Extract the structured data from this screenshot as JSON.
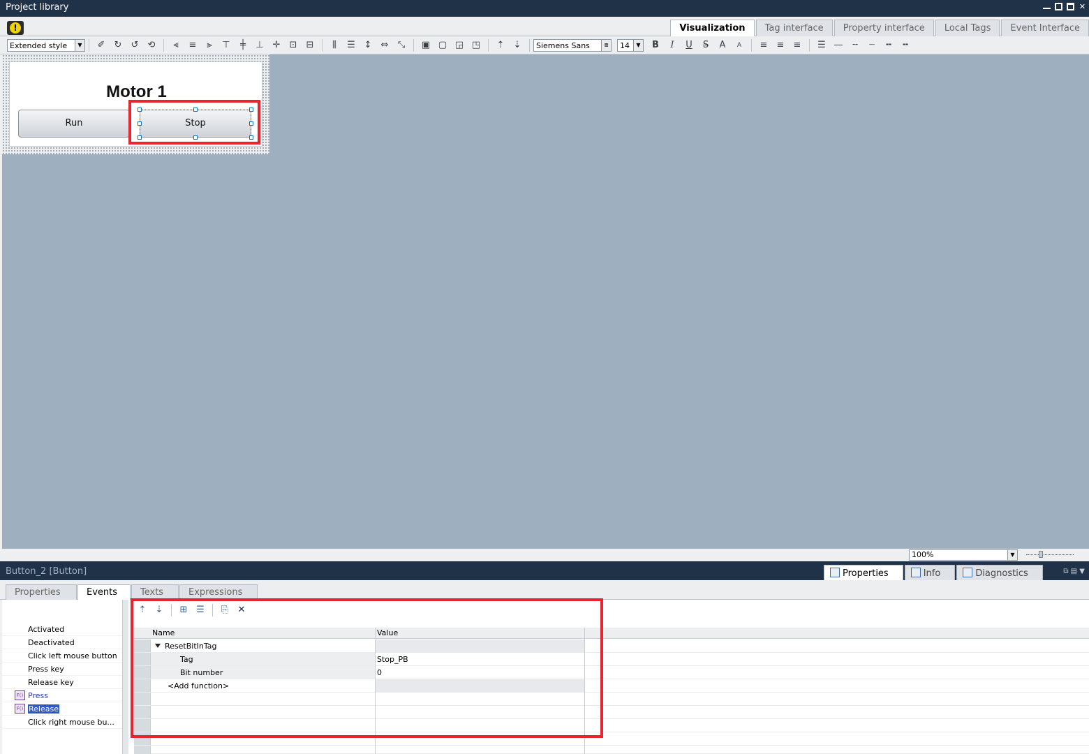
{
  "window": {
    "title": "Project library"
  },
  "top_tabs": [
    {
      "label": "Visualization",
      "active": true
    },
    {
      "label": "Tag interface",
      "active": false
    },
    {
      "label": "Property interface",
      "active": false
    },
    {
      "label": "Local Tags",
      "active": false
    },
    {
      "label": "Event Interface",
      "active": false
    }
  ],
  "toolbar": {
    "style_select": "Extended style",
    "font_select": "Siemens Sans",
    "size_select": "14",
    "bold": "B",
    "italic": "I",
    "underline": "U",
    "strike": "S",
    "grow": "A",
    "shrink": "A"
  },
  "canvas": {
    "screen_title": "Motor 1",
    "run_label": "Run",
    "stop_label": "Stop",
    "zoom": "100%"
  },
  "inspector": {
    "object": "Button_2 [Button]",
    "tabs": [
      {
        "label": "Properties",
        "active": true,
        "icon": "properties-icon"
      },
      {
        "label": "Info",
        "active": false,
        "icon": "info-icon"
      },
      {
        "label": "Diagnostics",
        "active": false,
        "icon": "diagnostics-icon"
      }
    ],
    "subtabs": [
      {
        "label": "Properties",
        "active": false
      },
      {
        "label": "Events",
        "active": true
      },
      {
        "label": "Texts",
        "active": false
      },
      {
        "label": "Expressions",
        "active": false
      }
    ],
    "events": [
      {
        "label": "Activated",
        "has_fn": false
      },
      {
        "label": "Deactivated",
        "has_fn": false
      },
      {
        "label": "Click left mouse button",
        "has_fn": false
      },
      {
        "label": "Press key",
        "has_fn": false
      },
      {
        "label": "Release key",
        "has_fn": false
      },
      {
        "label": "Press",
        "has_fn": true
      },
      {
        "label": "Release",
        "has_fn": true,
        "selected": true
      },
      {
        "label": "Click right mouse bu...",
        "has_fn": false
      }
    ],
    "fn_table": {
      "col_name": "Name",
      "col_value": "Value",
      "function": "ResetBitInTag",
      "params": [
        {
          "name": "Tag",
          "value": "Stop_PB"
        },
        {
          "name": "Bit number",
          "value": "0"
        }
      ],
      "add_function": "<Add function>"
    }
  },
  "colors": {
    "highlight": "#e8242f",
    "canvas_bg": "#9eafbf",
    "header_bg": "#1f3247"
  }
}
